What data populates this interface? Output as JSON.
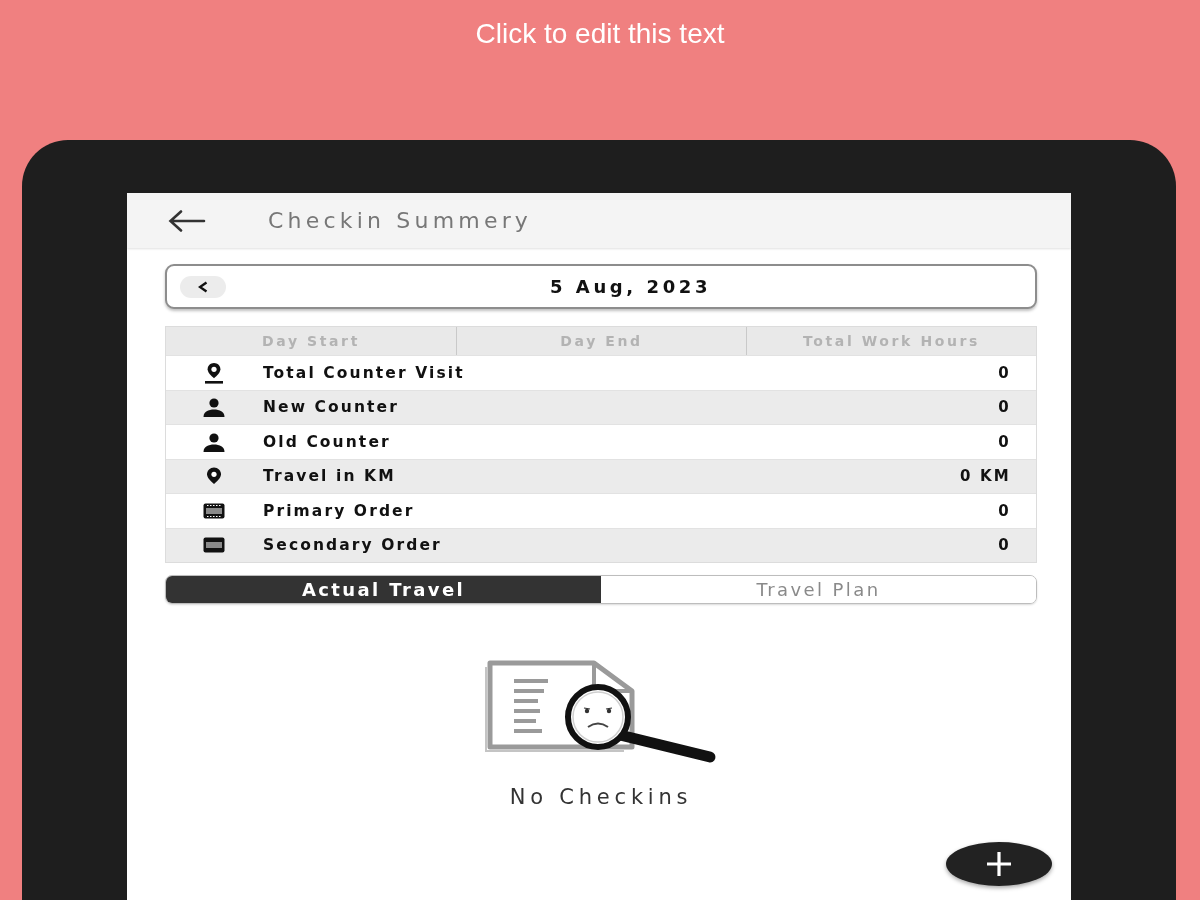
{
  "caption": {
    "text": "Click to edit this text"
  },
  "app_bar": {
    "title": "Checkin Summery"
  },
  "date_bar": {
    "date": "5 Aug, 2023"
  },
  "summary_table": {
    "columns": [
      "Day Start",
      "Day End",
      "Total Work Hours"
    ],
    "rows": [
      {
        "kind": "pin_base",
        "label": "Total Counter Visit",
        "value": "0"
      },
      {
        "kind": "person",
        "label": "New Counter",
        "value": "0"
      },
      {
        "kind": "person",
        "label": "Old Counter",
        "value": "0"
      },
      {
        "kind": "pin",
        "label": "Travel in KM",
        "value": "0 KM"
      },
      {
        "kind": "ticket",
        "label": "Primary Order",
        "value": "0"
      },
      {
        "kind": "card",
        "label": "Secondary Order",
        "value": "0"
      }
    ]
  },
  "tabs": [
    {
      "label": "Actual Travel",
      "selected": true
    },
    {
      "label": "Travel Plan",
      "selected": false
    }
  ],
  "empty_state": {
    "message": "No Checkins"
  }
}
